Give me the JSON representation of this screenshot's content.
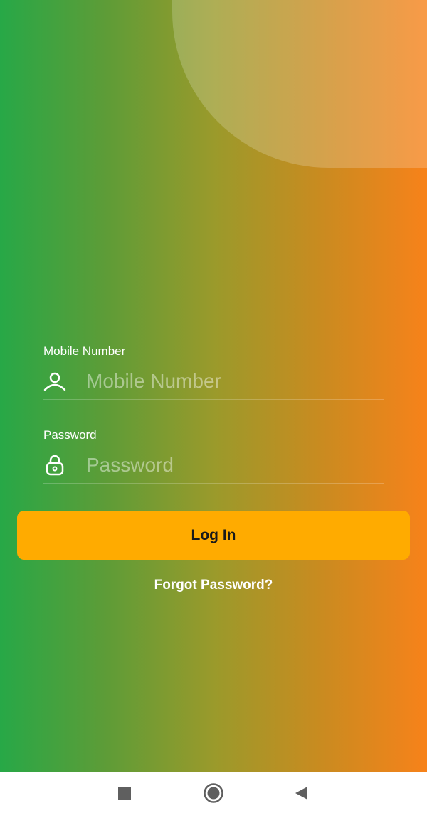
{
  "login_form": {
    "mobile": {
      "label": "Mobile Number",
      "placeholder": "Mobile Number",
      "value": "",
      "icon": "person-icon"
    },
    "password": {
      "label": "Password",
      "placeholder": "Password",
      "value": "",
      "icon": "lock-icon"
    },
    "login_label": "Log In",
    "forgot_label": "Forgot Password?"
  },
  "nav_bar": {
    "items": [
      {
        "icon": "recent-apps-icon"
      },
      {
        "icon": "home-icon"
      },
      {
        "icon": "back-icon"
      }
    ]
  },
  "colors": {
    "gradient_start": "#27a847",
    "gradient_end": "#f7821a",
    "button": "#ffab00"
  }
}
